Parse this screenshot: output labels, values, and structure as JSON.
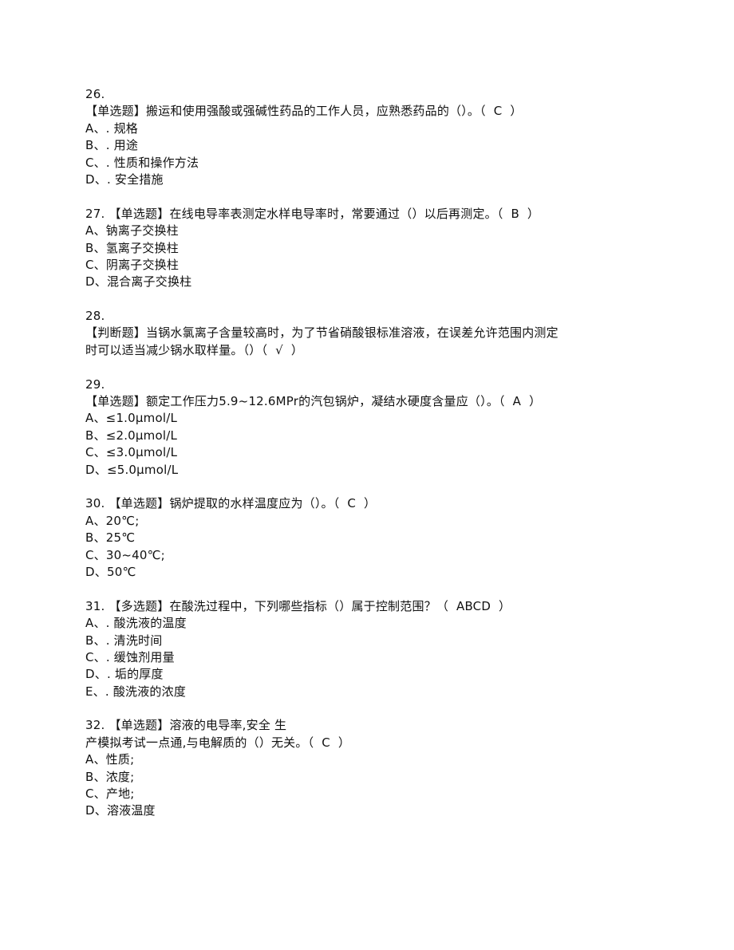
{
  "questions": [
    {
      "number": "26.",
      "number_on_own_line": true,
      "type": "【单选题】",
      "stem_lines": [
        "搬运和使用强酸或强碱性药品的工作人员，应熟悉药品的（）。（  C  ）"
      ],
      "answer": "C",
      "options": [
        {
          "label": "A、",
          "text": ". 规格"
        },
        {
          "label": "B、",
          "text": ". 用途"
        },
        {
          "label": "C、",
          "text": ". 性质和操作方法"
        },
        {
          "label": "D、",
          "text": ". 安全措施"
        }
      ]
    },
    {
      "number": "27.",
      "number_on_own_line": false,
      "type": "【单选题】",
      "stem_lines": [
        "在线电导率表测定水样电导率时，常要通过（）以后再测定。（  B  ）"
      ],
      "answer": "B",
      "options": [
        {
          "label": "A、",
          "text": "钠离子交换柱"
        },
        {
          "label": "B、",
          "text": "氢离子交换柱"
        },
        {
          "label": "C、",
          "text": "阴离子交换柱"
        },
        {
          "label": "D、",
          "text": "混合离子交换柱"
        }
      ]
    },
    {
      "number": "28.",
      "number_on_own_line": true,
      "type": "【判断题】",
      "stem_lines": [
        "当锅水氯离子含量较高时，为了节省硝酸银标准溶液，在误差允许范围内测定",
        "时可以适当减少锅水取样量。（）（  √  ）"
      ],
      "answer": "√",
      "options": []
    },
    {
      "number": "29.",
      "number_on_own_line": true,
      "type": "【单选题】",
      "stem_lines": [
        "额定工作压力5.9~12.6MPr的汽包锅炉，凝结水硬度含量应（）。（  A  ）"
      ],
      "answer": "A",
      "options": [
        {
          "label": "A、",
          "text": "≤1.0μmol/L"
        },
        {
          "label": "B、",
          "text": "≤2.0μmol/L"
        },
        {
          "label": "C、",
          "text": "≤3.0μmol/L"
        },
        {
          "label": "D、",
          "text": "≤5.0μmol/L"
        }
      ]
    },
    {
      "number": "30.",
      "number_on_own_line": false,
      "type": "【单选题】",
      "stem_lines": [
        "锅炉提取的水样温度应为（）。（  C  ）"
      ],
      "answer": "C",
      "options": [
        {
          "label": "A、",
          "text": "20℃;"
        },
        {
          "label": "B、",
          "text": "25℃"
        },
        {
          "label": "C、",
          "text": "30~40℃;"
        },
        {
          "label": "D、",
          "text": "50℃"
        }
      ]
    },
    {
      "number": "31.",
      "number_on_own_line": false,
      "type": "【多选题】",
      "stem_lines": [
        "在酸洗过程中，下列哪些指标（）属于控制范围？（  ABCD  ）"
      ],
      "answer": "ABCD",
      "options": [
        {
          "label": "A、",
          "text": ". 酸洗液的温度"
        },
        {
          "label": "B、",
          "text": ". 清洗时间"
        },
        {
          "label": "C、",
          "text": ". 缓蚀剂用量"
        },
        {
          "label": "D、",
          "text": ". 垢的厚度"
        },
        {
          "label": "E、",
          "text": ". 酸洗液的浓度"
        }
      ]
    },
    {
      "number": "32.",
      "number_on_own_line": false,
      "type": "【单选题】",
      "stem_lines": [
        "溶液的电导率,安全 生",
        "产模拟考试一点通,与电解质的（）无关。（  C  ）"
      ],
      "answer": "C",
      "options": [
        {
          "label": "A、",
          "text": "性质;"
        },
        {
          "label": "B、",
          "text": "浓度;"
        },
        {
          "label": "C、",
          "text": "产地;"
        },
        {
          "label": "D、",
          "text": "溶液温度"
        }
      ]
    }
  ]
}
